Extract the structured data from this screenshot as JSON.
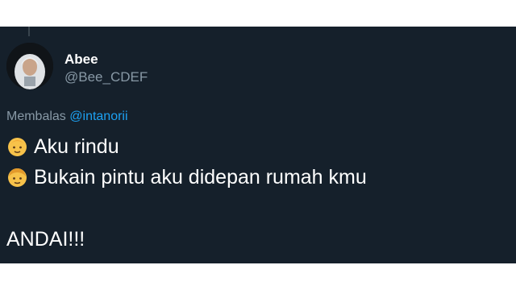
{
  "tweet": {
    "author": {
      "display_name": "Abee",
      "handle": "@Bee_CDEF"
    },
    "reply": {
      "prefix": "Membalas",
      "mention": "@intanorii"
    },
    "lines": [
      {
        "emoji": "baby-emoji",
        "text": "Aku rindu"
      },
      {
        "emoji": "boy-emoji",
        "text": "Bukain pintu aku didepan rumah kmu"
      },
      {
        "text": "ANDAI!!!"
      }
    ]
  },
  "colors": {
    "background": "#15202b",
    "text": "#ffffff",
    "muted": "#8899a6",
    "link": "#1da1f2"
  }
}
